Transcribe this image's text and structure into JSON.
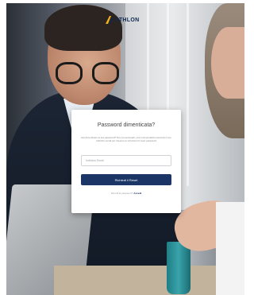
{
  "brand": {
    "logo_text": "ATHLON",
    "logo_icon": "athlon-chevron-logo",
    "primary_color": "#1a3566"
  },
  "card": {
    "title": "Password dimenticata?",
    "description": "Hai dimenticato la tua password? Non preoccuparti, puoi reimpostarla inserendo il tuo indirizzo email per ricevere le istruzioni di reset password",
    "email_placeholder": "Indirizzo Email",
    "email_value": "",
    "submit_label": "Richiedi il Reset",
    "footer_text": "Ricordi la password?",
    "footer_link": "Accedi"
  }
}
